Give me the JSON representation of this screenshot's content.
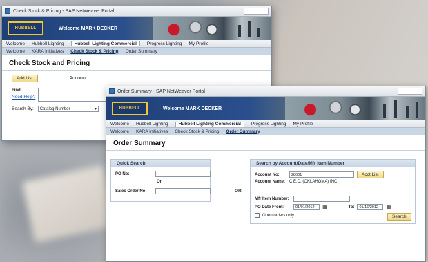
{
  "back_window": {
    "title": "Check Stock & Pricing - SAP NetWeaver Portal",
    "logo": "HUBBELL",
    "welcome": "Welcome MARK DECKER",
    "nav_primary": [
      "Welcome",
      "Hubbell Lighting",
      "Hubbell Lighting Commercial",
      "Progress Lighting",
      "My Profile"
    ],
    "nav_primary_active": 2,
    "nav_secondary": [
      "Welcome",
      "KARA Initiatives",
      "Check Stock & Pricing",
      "Order Summary"
    ],
    "nav_secondary_active": 2,
    "page_title": "Check Stock and Pricing",
    "add_list_button": "Add List",
    "account_label": "Account",
    "find_label": "Find:",
    "need_help_link": "Need Help?",
    "search_by_label": "Search By:",
    "search_by_value": "Catalog Number"
  },
  "front_window": {
    "title": "Order Summary - SAP NetWeaver Portal",
    "logo": "HUBBELL",
    "welcome": "Welcome MARK DECKER",
    "nav_primary": [
      "Welcome",
      "Hubbell Lighting",
      "Hubbell Lighting Commercial",
      "Progress Lighting",
      "My Profile"
    ],
    "nav_primary_active": 2,
    "nav_secondary": [
      "Welcome",
      "KARA Initiatives",
      "Check Stock & Pricing",
      "Order Summary"
    ],
    "nav_secondary_active": 3,
    "page_title": "Order Summary",
    "quick_search": {
      "heading": "Quick Search",
      "po_label": "PO No:",
      "or_label": "Or",
      "sales_order_label": "Sales Order No:"
    },
    "or_separator": "OR",
    "account_search": {
      "heading": "Search by Account/Date/Mfr Item Number",
      "account_no_label": "Account No:",
      "account_no_value": "28001",
      "account_list_button": "Acct List",
      "account_name_label": "Account Name:",
      "account_name_value": "C.E.D. (OKLAHOMA) INC",
      "mfr_item_label": "Mfr Item Number:",
      "po_date_from_label": "PO Date From:",
      "po_date_from_value": "01/01/2012",
      "to_label": "To:",
      "po_date_to_value": "01/16/2012",
      "open_orders_label": "Open orders only",
      "search_button": "Search"
    }
  }
}
